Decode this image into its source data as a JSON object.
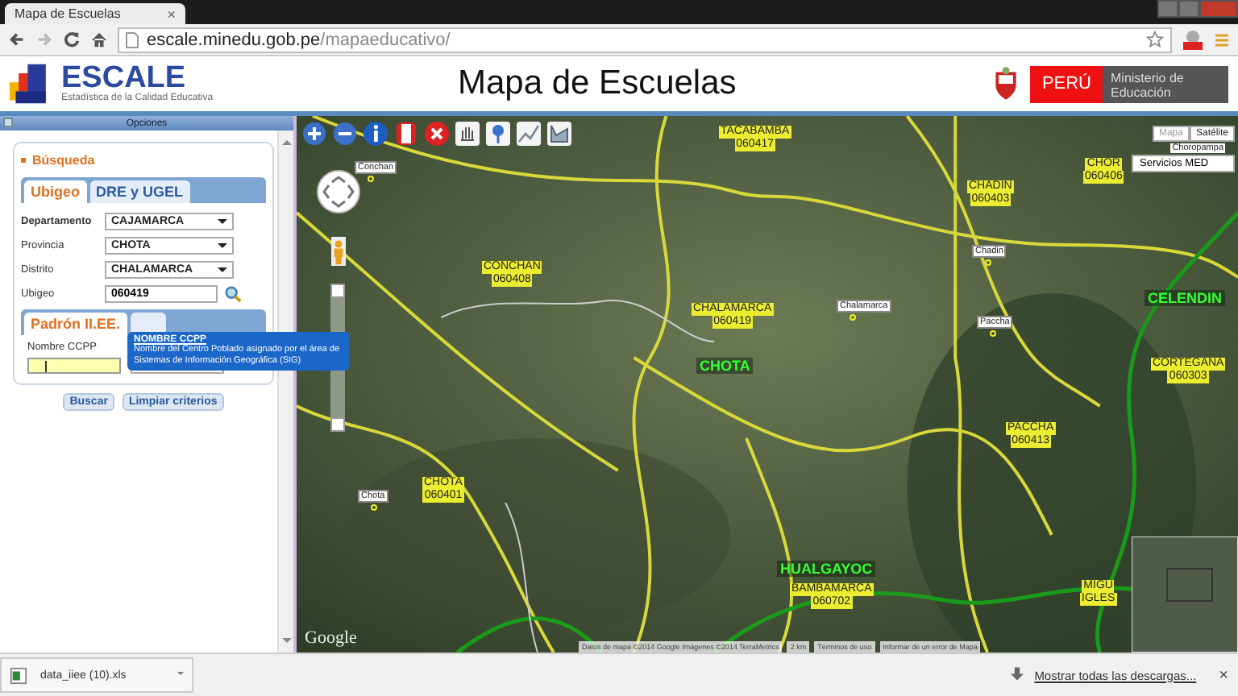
{
  "browser": {
    "tab_title": "Mapa de Escuelas",
    "tab_close": "×",
    "url_host": "escale.minedu.gob.pe",
    "url_path": "/mapaeducativo/"
  },
  "header": {
    "logo": "ESCALE",
    "logo_subtitle": "Estadística de la Calidad Educativa",
    "title": "Mapa de Escuelas",
    "country": "PERÚ",
    "ministry": "Ministerio de Educación"
  },
  "panel": {
    "title": "Opciones",
    "section": "Búsqueda",
    "tabs": [
      {
        "label": "Ubigeo",
        "selected": true
      },
      {
        "label": "DRE y UGEL",
        "selected": false
      }
    ],
    "fields": [
      {
        "label": "Departamento",
        "value": "CAJAMARCA",
        "kind": "select"
      },
      {
        "label": "Provincia",
        "value": "CHOTA",
        "kind": "select"
      },
      {
        "label": "Distrito",
        "value": "CHALAMARCA",
        "kind": "select"
      },
      {
        "label": "Ubigeo",
        "value": "060419",
        "kind": "text"
      }
    ],
    "tabs_2": [
      {
        "label": "Padrón II.EE.",
        "selected": true
      }
    ],
    "name_label": "Nombre CCPP",
    "tooltip": {
      "title": "NOMBRE CCPP",
      "text": "Nombre del Centro Poblado asignado por el área de Sistemas de Información Geográfica (SIG)"
    },
    "buttons": [
      "Buscar",
      "Limpiar criterios"
    ]
  },
  "map": {
    "types": [
      {
        "label": "Mapa",
        "selected": false
      },
      {
        "label": "Satélite",
        "selected": true
      }
    ],
    "zoom": {
      "level": 0.55
    },
    "overlay_label": "Choropampa",
    "services": "Servicios MED",
    "labels": [
      {
        "kind": "town",
        "name": "Conchan"
      },
      {
        "kind": "district",
        "name": "TACABAMBA",
        "code": "060417"
      },
      {
        "kind": "district",
        "name": "CHADIN",
        "code": "060403"
      },
      {
        "kind": "district",
        "name": "CHOR",
        "code": "060406"
      },
      {
        "kind": "district",
        "name": "CONCHAN",
        "code": "060408"
      },
      {
        "kind": "district",
        "name": "CHALAMARCA",
        "code": "060419"
      },
      {
        "kind": "town",
        "name": "Chalamarca"
      },
      {
        "kind": "town",
        "name": "Chadin"
      },
      {
        "kind": "town",
        "name": "Paccha"
      },
      {
        "kind": "province",
        "name": "CHOTA"
      },
      {
        "kind": "province",
        "name": "CELENDIN"
      },
      {
        "kind": "district",
        "name": "CORTEGANA",
        "code": "060303"
      },
      {
        "kind": "district",
        "name": "PACCHA",
        "code": "060413"
      },
      {
        "kind": "town",
        "name": "Chota"
      },
      {
        "kind": "district",
        "name": "CHOTA",
        "code": "060401"
      },
      {
        "kind": "province",
        "name": "HUALGAYOC"
      },
      {
        "kind": "district",
        "name": "BAMBAMARCA",
        "code": "060702"
      },
      {
        "kind": "district",
        "name": "MIGU",
        "code": "IGLES"
      }
    ],
    "logo": "Google",
    "attribution": [
      "Datos de mapa ©2014 Google Imágenes ©2014 TerraMetrics",
      "2 km",
      "Términos de uso",
      "Informar de un error de Mapa"
    ]
  },
  "downloads": {
    "file": "data_iiee (10).xls",
    "show_all": "Mostrar todas las descargas...",
    "close": "×"
  }
}
